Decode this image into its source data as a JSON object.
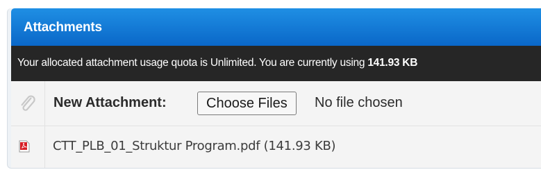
{
  "attachments": {
    "title": "Attachments",
    "quota": {
      "prefix": "Your allocated attachment usage quota is Unlimited. You are currently using ",
      "usage": "141.93 KB"
    },
    "upload": {
      "label": "New Attachment:",
      "button_label": "Choose Files",
      "status": "No file chosen"
    },
    "files": [
      {
        "name": "CTT_PLB_01_Struktur Program.pdf (141.93 KB)",
        "icon": "pdf-file-icon"
      }
    ]
  },
  "colors": {
    "header_gradient_top": "#1f8fe4",
    "header_gradient_bottom": "#0a67c8",
    "quota_bar": "#262626",
    "row_background": "#f4f4f4",
    "pdf_red": "#d71f26"
  }
}
